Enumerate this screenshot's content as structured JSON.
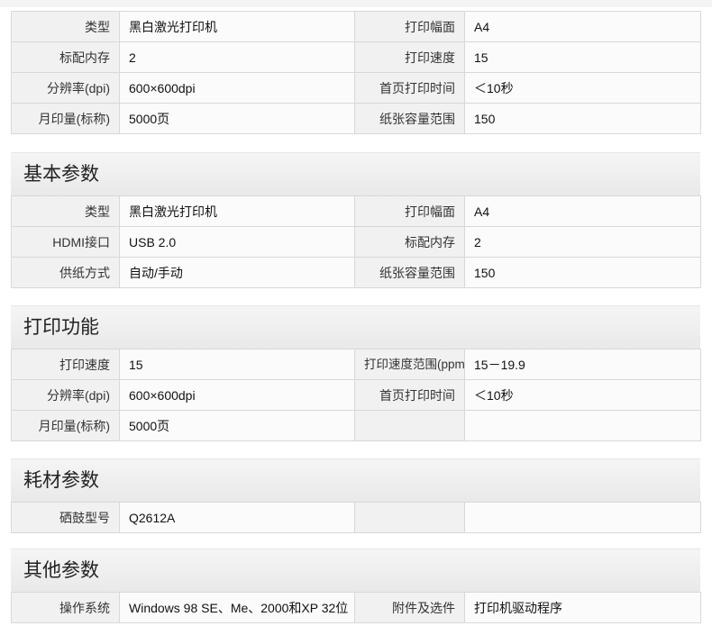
{
  "sections": [
    {
      "title": "",
      "rows": [
        [
          "类型",
          "黑白激光打印机",
          "打印幅面",
          "A4"
        ],
        [
          "标配内存",
          "2",
          "打印速度",
          "15"
        ],
        [
          "分辨率(dpi)",
          "600×600dpi",
          "首页打印时间",
          "＜10秒"
        ],
        [
          "月印量(标称)",
          "5000页",
          "纸张容量范围",
          "150"
        ]
      ]
    },
    {
      "title": "基本参数",
      "rows": [
        [
          "类型",
          "黑白激光打印机",
          "打印幅面",
          "A4"
        ],
        [
          "HDMI接口",
          "USB 2.0",
          "标配内存",
          "2"
        ],
        [
          "供纸方式",
          "自动/手动",
          "纸张容量范围",
          "150"
        ]
      ]
    },
    {
      "title": "打印功能",
      "rows": [
        [
          "打印速度",
          "15",
          "打印速度范围(ppm)",
          "15－19.9"
        ],
        [
          "分辨率(dpi)",
          "600×600dpi",
          "首页打印时间",
          "＜10秒"
        ],
        [
          "月印量(标称)",
          "5000页",
          "",
          ""
        ]
      ]
    },
    {
      "title": "耗材参数",
      "rows": [
        [
          "硒鼓型号",
          "Q2612A",
          "",
          ""
        ]
      ]
    },
    {
      "title": "其他参数",
      "rows": [
        [
          "操作系统",
          "Windows 98 SE、Me、2000和XP 32位",
          "附件及选件",
          "打印机驱动程序"
        ]
      ]
    }
  ]
}
